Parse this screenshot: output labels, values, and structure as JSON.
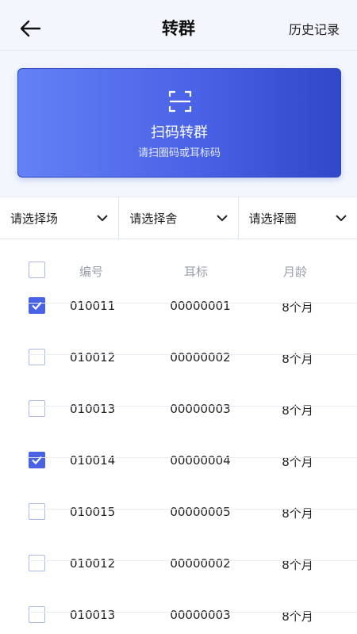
{
  "header": {
    "title": "转群",
    "history_label": "历史记录"
  },
  "scan_card": {
    "title": "扫码转群",
    "subtitle": "请扫圈码或耳标码"
  },
  "filters": [
    {
      "label": "请选择场"
    },
    {
      "label": "请选择舍"
    },
    {
      "label": "请选择圈"
    }
  ],
  "table": {
    "headers": {
      "code": "编号",
      "ear_tag": "耳标",
      "age": "月龄"
    },
    "select_all_checked": false,
    "rows": [
      {
        "checked": true,
        "code": "010011",
        "ear_tag": "00000001",
        "age": "8个月"
      },
      {
        "checked": false,
        "code": "010012",
        "ear_tag": "00000002",
        "age": "8个月"
      },
      {
        "checked": false,
        "code": "010013",
        "ear_tag": "00000003",
        "age": "8个月"
      },
      {
        "checked": true,
        "code": "010014",
        "ear_tag": "00000004",
        "age": "8个月"
      },
      {
        "checked": false,
        "code": "010015",
        "ear_tag": "00000005",
        "age": "8个月"
      },
      {
        "checked": false,
        "code": "010012",
        "ear_tag": "00000002",
        "age": "8个月"
      },
      {
        "checked": false,
        "code": "010013",
        "ear_tag": "00000003",
        "age": "8个月"
      }
    ]
  },
  "icons": {
    "back": "arrow-left-icon",
    "scan": "scan-frame-icon",
    "dropdown": "chevron-down-icon",
    "check": "checkmark-icon"
  },
  "colors": {
    "accent": "#4a62e6",
    "card_gradient_start": "#6481f5",
    "card_gradient_end": "#3047c9",
    "top_background": "#f3f7fd"
  }
}
